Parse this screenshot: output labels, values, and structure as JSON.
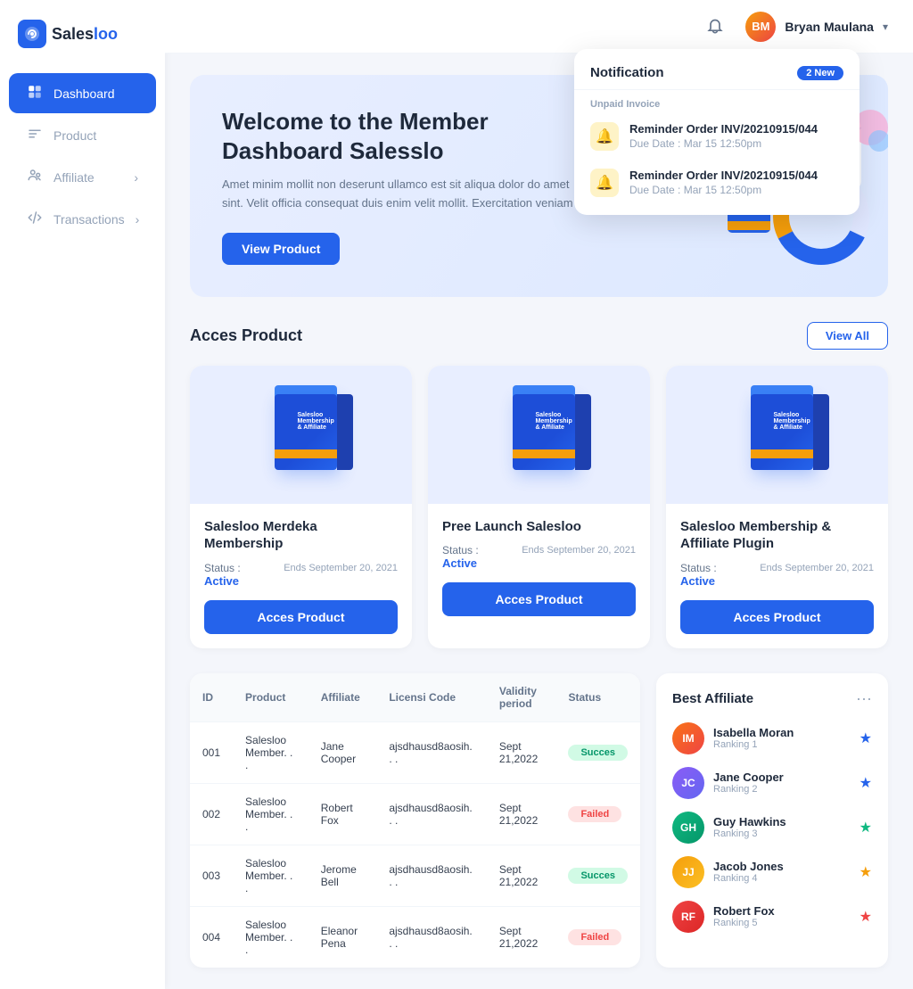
{
  "sidebar": {
    "logo_text1": "Sales",
    "logo_text2": "loo",
    "items": [
      {
        "id": "dashboard",
        "label": "Dashboard",
        "active": true,
        "has_chevron": false
      },
      {
        "id": "product",
        "label": "Product",
        "active": false,
        "has_chevron": false
      },
      {
        "id": "affiliate",
        "label": "Affiliate",
        "active": false,
        "has_chevron": true
      },
      {
        "id": "transactions",
        "label": "Transactions",
        "active": false,
        "has_chevron": true
      }
    ]
  },
  "topbar": {
    "user_name": "Bryan Maulana",
    "user_initials": "BM"
  },
  "notification": {
    "title": "Notification",
    "badge": "2 New",
    "section_label": "Unpaid Invoice",
    "items": [
      {
        "title": "Reminder Order INV/20210915/044",
        "due": "Due Date : Mar 15 12:50pm"
      },
      {
        "title": "Reminder Order INV/20210915/044",
        "due": "Due Date : Mar 15 12:50pm"
      }
    ]
  },
  "hero": {
    "title": "Welcome to the Member Dashboard Salesslo",
    "description": "Amet minim mollit non deserunt ullamco est sit aliqua dolor do amet sint. Velit officia consequat duis enim velit mollit. Exercitation veniam",
    "button_label": "View Product"
  },
  "products_section": {
    "title": "Acces Product",
    "view_all_label": "View All",
    "products": [
      {
        "name": "Salesloo Merdeka Membership",
        "status_label": "Status :",
        "status_value": "Active",
        "ends": "Ends September 20, 2021",
        "button_label": "Acces Product",
        "logo": "Salesloo"
      },
      {
        "name": "Pree Launch Salesloo",
        "status_label": "Status :",
        "status_value": "Active",
        "ends": "Ends September 20, 2021",
        "button_label": "Acces Product",
        "logo": "Salesloo"
      },
      {
        "name": "Salesloo Membership & Affiliate Plugin",
        "status_label": "Status :",
        "status_value": "Active",
        "ends": "Ends September 20, 2021",
        "button_label": "Acces Product",
        "logo": "Salesloo"
      }
    ]
  },
  "table": {
    "columns": [
      "ID",
      "Product",
      "Affiliate",
      "Licensi Code",
      "Validity period",
      "Status"
    ],
    "rows": [
      {
        "id": "001",
        "product": "Salesloo Member. . .",
        "affiliate": "Jane Cooper",
        "license": "ajsdhausd8aosih. . .",
        "validity": "Sept 21,2022",
        "status": "Succes",
        "status_type": "success"
      },
      {
        "id": "002",
        "product": "Salesloo Member. . .",
        "affiliate": "Robert Fox",
        "license": "ajsdhausd8aosih. . .",
        "validity": "Sept 21,2022",
        "status": "Failed",
        "status_type": "failed"
      },
      {
        "id": "003",
        "product": "Salesloo Member. . .",
        "affiliate": "Jerome Bell",
        "license": "ajsdhausd8aosih. . .",
        "validity": "Sept 21,2022",
        "status": "Succes",
        "status_type": "success"
      },
      {
        "id": "004",
        "product": "Salesloo Member. . .",
        "affiliate": "Eleanor Pena",
        "license": "ajsdhausd8aosih. . .",
        "validity": "Sept 21,2022",
        "status": "Failed",
        "status_type": "failed"
      }
    ]
  },
  "best_affiliate": {
    "title": "Best Affiliate",
    "items": [
      {
        "name": "Isabella Moran",
        "rank": "Ranking 1",
        "star": "⭐",
        "star_color": "#2563eb",
        "initials": "IM",
        "av_class": "av1"
      },
      {
        "name": "Jane Cooper",
        "rank": "Ranking 2",
        "star": "⭐",
        "star_color": "#2563eb",
        "initials": "JC",
        "av_class": "av2"
      },
      {
        "name": "Guy Hawkins",
        "rank": "Ranking 3",
        "star": "⭐",
        "star_color": "#10b981",
        "initials": "GH",
        "av_class": "av3"
      },
      {
        "name": "Jacob Jones",
        "rank": "Ranking 4",
        "star": "⭐",
        "star_color": "#f59e0b",
        "initials": "JJ",
        "av_class": "av4"
      },
      {
        "name": "Robert Fox",
        "rank": "Ranking 5",
        "star": "⭐",
        "star_color": "#ef4444",
        "initials": "RF",
        "av_class": "av5"
      }
    ]
  }
}
